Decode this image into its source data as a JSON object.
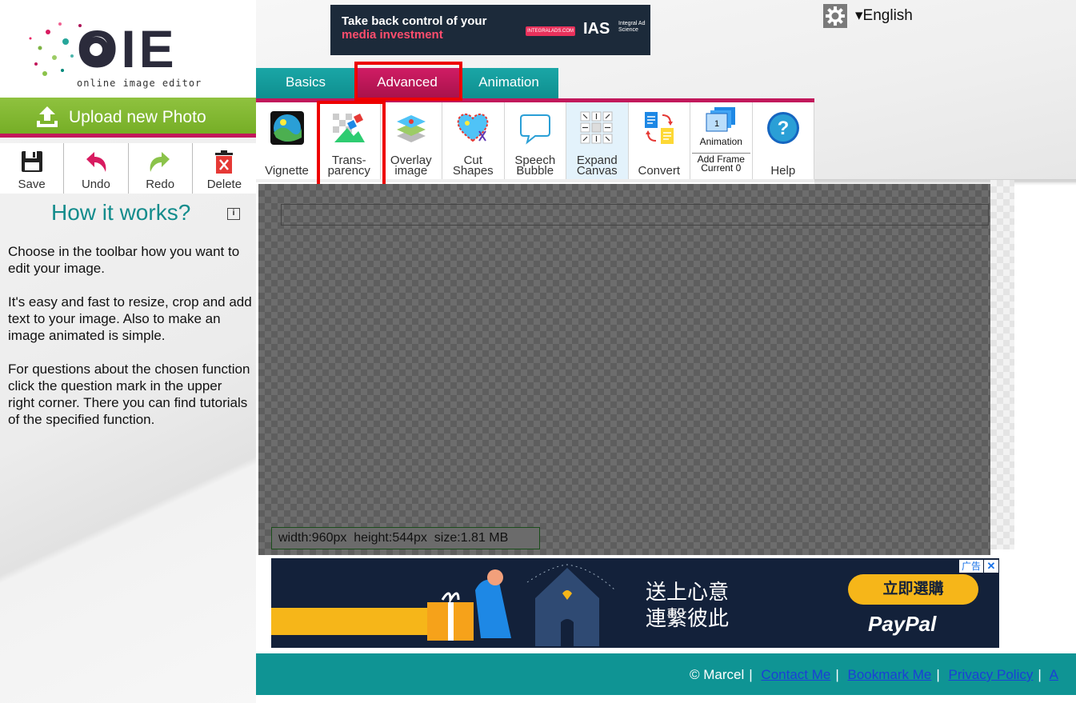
{
  "logo": {
    "text": "OIE",
    "tagline": "online image editor"
  },
  "sidebar": {
    "upload_label": "Upload new Photo",
    "actions": [
      {
        "label": "Save",
        "icon": "save-icon"
      },
      {
        "label": "Undo",
        "icon": "undo-icon"
      },
      {
        "label": "Redo",
        "icon": "redo-icon"
      },
      {
        "label": "Delete",
        "icon": "delete-icon"
      }
    ],
    "howto_title": "How it works?",
    "howto_paragraphs": [
      "Choose in the toolbar how you want to edit your image.",
      "It's easy and fast to resize, crop and add text to your image. Also to make an image animated is simple.",
      "For questions about the chosen function click the question mark in the upper right corner. There you can find tutorials of the specified function."
    ]
  },
  "header": {
    "language": "▾English",
    "ad_top": {
      "line1": "Take back control of your",
      "line2": "media investment",
      "pill": "INTEGRALADS.COM",
      "brand": "IAS",
      "brand_sub": "Integral Ad Science"
    }
  },
  "tabs": [
    {
      "label": "Basics",
      "active": false
    },
    {
      "label": "Advanced",
      "active": true
    },
    {
      "label": "Animation",
      "active": false
    }
  ],
  "toolbar": [
    {
      "label": "Vignette",
      "icon": "vignette-icon"
    },
    {
      "label": "Trans-\nparency",
      "icon": "transparency-icon"
    },
    {
      "label": "Overlay\nimage",
      "icon": "overlay-image-icon"
    },
    {
      "label": "Cut\nShapes",
      "icon": "cut-shapes-icon"
    },
    {
      "label": "Speech\nBubble",
      "icon": "speech-bubble-icon"
    },
    {
      "label": "Expand\nCanvas",
      "icon": "expand-canvas-icon"
    },
    {
      "label": "Convert",
      "icon": "convert-icon"
    },
    {
      "label": "Animation",
      "sub1": "Add Frame",
      "sub2": "Current 0",
      "icon": "animation-frames-icon"
    },
    {
      "label": "Help",
      "icon": "help-icon"
    }
  ],
  "canvas": {
    "info": "width:960px  height:544px  size:1.81 MB"
  },
  "ad_bottom": {
    "headline": "送上心意\n連繫彼此",
    "button": "立即選購",
    "brand": "PayPal",
    "ad_tag": "广告",
    "close": "✕"
  },
  "footer": {
    "copyright": "© Marcel",
    "links": [
      "Contact Me",
      "Bookmark Me",
      "Privacy Policy",
      "A"
    ]
  },
  "colors": {
    "teal": "#0f9494",
    "magenta": "#c2185b",
    "green": "#8fc23f",
    "highlight_red": "#ee0000"
  }
}
